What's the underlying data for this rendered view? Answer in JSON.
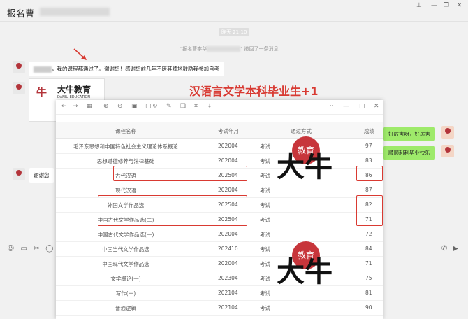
{
  "window": {
    "title": "报名曹",
    "controls": [
      "pin-icon",
      "minimize-icon",
      "maximize-icon",
      "close-icon"
    ]
  },
  "chat": {
    "time": "昨天 21:10",
    "system_prefix": "\"报名曹李华",
    "system_suffix": "\" 撤回了一条消息",
    "msg1_text": "，我的课程都通过了。谢谢您！感谢您前几年不厌其烦地鼓励我参加自考",
    "card_brand": "大牛教育",
    "card_sub": "DANIU EDUCATION",
    "headline": "汉语言文学本科毕业生+1",
    "reply1": "好厉害呀，好厉害",
    "reply2": "顺顺利利毕业快乐",
    "msg2_text": "谢谢您"
  },
  "table": {
    "headers": [
      "课程名称",
      "考试年月",
      "通过方式",
      "成绩"
    ],
    "rows": [
      {
        "name": "毛泽东思想和中国特色社会主义理论体系概论",
        "date": "202004",
        "method": "考试",
        "score": "97"
      },
      {
        "name": "思想道德修养与法律基础",
        "date": "202004",
        "method": "考试",
        "score": "83"
      },
      {
        "name": "古代汉语",
        "date": "202504",
        "method": "考试",
        "score": "86"
      },
      {
        "name": "现代汉语",
        "date": "202004",
        "method": "考试",
        "score": "87"
      },
      {
        "name": "外国文学作品选",
        "date": "202504",
        "method": "考试",
        "score": "82"
      },
      {
        "name": "中国古代文学作品选(二)",
        "date": "202504",
        "method": "考试",
        "score": "71"
      },
      {
        "name": "中国古代文学作品选(一)",
        "date": "202004",
        "method": "考试",
        "score": "72"
      },
      {
        "name": "中国当代文学作品选",
        "date": "202410",
        "method": "考试",
        "score": "84"
      },
      {
        "name": "中国现代文学作品选",
        "date": "202004",
        "method": "考试",
        "score": "71"
      },
      {
        "name": "文学概论(一)",
        "date": "202304",
        "method": "考试",
        "score": "75"
      },
      {
        "name": "写作(一)",
        "date": "202104",
        "method": "考试",
        "score": "81"
      },
      {
        "name": "普通逻辑",
        "date": "202104",
        "method": "考试",
        "score": "90"
      }
    ]
  },
  "watermark": {
    "big": "大牛",
    "small": "教育"
  },
  "colors": {
    "accent": "#d83a32",
    "bubble_green": "#9eea6a"
  }
}
